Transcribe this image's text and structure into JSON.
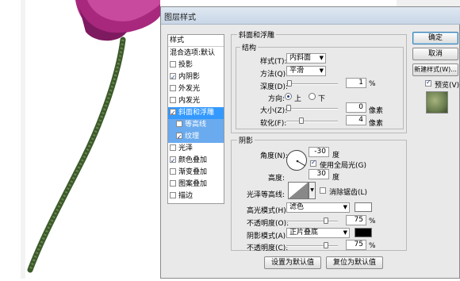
{
  "dialog": {
    "title": "图层样式"
  },
  "styles_panel": {
    "header": "样式",
    "items": [
      {
        "label": "混合选项:默认",
        "checkbox": false,
        "checked": false
      },
      {
        "label": "投影",
        "checkbox": true,
        "checked": false
      },
      {
        "label": "内阴影",
        "checkbox": true,
        "checked": true
      },
      {
        "label": "外发光",
        "checkbox": true,
        "checked": false
      },
      {
        "label": "内发光",
        "checkbox": true,
        "checked": false
      },
      {
        "label": "斜面和浮雕",
        "checkbox": true,
        "checked": true
      },
      {
        "label": "等高线",
        "checkbox": true,
        "checked": false
      },
      {
        "label": "纹理",
        "checkbox": true,
        "checked": true
      },
      {
        "label": "光泽",
        "checkbox": true,
        "checked": false
      },
      {
        "label": "颜色叠加",
        "checkbox": true,
        "checked": true
      },
      {
        "label": "渐变叠加",
        "checkbox": true,
        "checked": false
      },
      {
        "label": "图案叠加",
        "checkbox": true,
        "checked": false
      },
      {
        "label": "描边",
        "checkbox": true,
        "checked": false
      }
    ]
  },
  "bevel": {
    "group_title": "斜面和浮雕",
    "structure_title": "结构",
    "style_label": "样式(T):",
    "style_value": "内斜面",
    "technique_label": "方法(Q):",
    "technique_value": "平滑",
    "depth_label": "深度(D):",
    "depth_value": "1",
    "depth_unit": "%",
    "depth_level": 0.01,
    "direction_label": "方向:",
    "direction_up": "上",
    "direction_down": "下",
    "size_label": "大小(Z):",
    "size_value": "0",
    "size_unit": "像素",
    "size_level": 0.0,
    "soften_label": "软化(F):",
    "soften_value": "4",
    "soften_unit": "像素",
    "soften_level": 0.25
  },
  "shading": {
    "title": "阴影",
    "angle_label": "角度(N):",
    "angle_value": "-30",
    "angle_unit": "度",
    "global_light_label": "使用全局光(G)",
    "global_light_checked": true,
    "altitude_label": "高度:",
    "altitude_value": "30",
    "altitude_unit": "度",
    "gloss_contour_label": "光泽等高线:",
    "antialias_label": "消除锯齿(L)",
    "antialias_checked": false,
    "highlight_mode_label": "高光模式(H):",
    "highlight_mode_value": "滤色",
    "highlight_color": "#ffffff",
    "highlight_opacity_label": "不透明度(O):",
    "highlight_opacity_value": "75",
    "highlight_opacity_unit": "%",
    "highlight_opacity_level": 0.75,
    "shadow_mode_label": "阴影模式(A):",
    "shadow_mode_value": "正片叠底",
    "shadow_color": "#000000",
    "shadow_opacity_label": "不透明度(C):",
    "shadow_opacity_value": "75",
    "shadow_opacity_unit": "%",
    "shadow_opacity_level": 0.75
  },
  "buttons": {
    "ok": "确定",
    "cancel": "取消",
    "new_style": "新建样式(W)...",
    "preview": "预览(V)",
    "set_default": "设置为默认值",
    "reset_default": "复位为默认值"
  },
  "colors": {
    "selection": "#3399ff",
    "preview_texture": "#6b7f4f"
  }
}
